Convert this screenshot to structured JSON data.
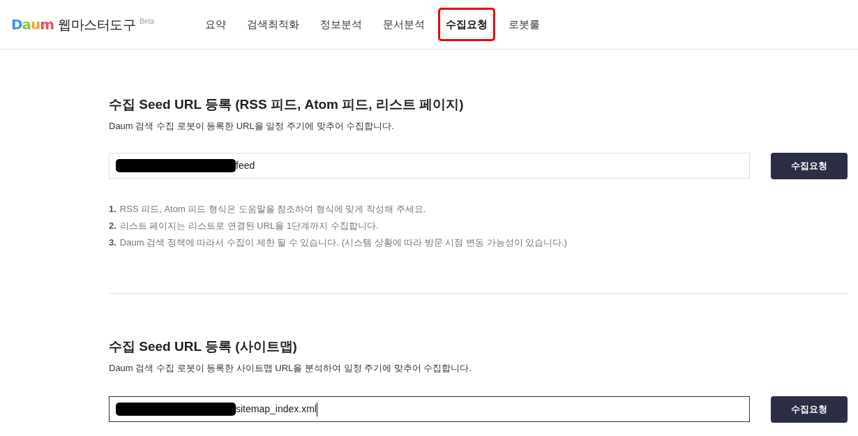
{
  "header": {
    "logo": [
      {
        "char": "D",
        "color": "#3f8ff0"
      },
      {
        "char": "a",
        "color": "#8dc63f"
      },
      {
        "char": "u",
        "color": "#f7a823"
      },
      {
        "char": "m",
        "color": "#ee4b5a"
      }
    ],
    "title": "웹마스터도구",
    "badge": "Beta"
  },
  "tabs": [
    {
      "label": "요약",
      "selected": false
    },
    {
      "label": "검색최적화",
      "selected": false
    },
    {
      "label": "정보분석",
      "selected": false
    },
    {
      "label": "문서분석",
      "selected": false
    },
    {
      "label": "수집요청",
      "selected": true
    },
    {
      "label": "로봇룰",
      "selected": false
    }
  ],
  "sections": [
    {
      "title": "수집 Seed URL 등록 (RSS 피드, Atom 피드, 리스트 페이지)",
      "description": "Daum 검색 수집 로봇이 등록한 URL을 일정 주기에 맞추어 수집합니다.",
      "field": {
        "redacted": true,
        "value": "feed",
        "focused": false
      },
      "button": "수집요청",
      "notes": [
        {
          "number": "1.",
          "text": "RSS 피드, Atom 피드 형식은 도움말을 참조하여 형식에 맞게 작성해 주세요."
        },
        {
          "number": "2.",
          "text": "리스트 페이지는 리스트로 연결된 URL을 1단계까지 수집합니다."
        },
        {
          "number": "3.",
          "text": "Daum 검색 정책에 따라서 수집이 제한 될 수 있습니다. (시스템 상황에 따라 방문 시점 변동 가능성이 있습니다.)"
        }
      ]
    },
    {
      "title": "수집 Seed URL 등록 (사이트맵)",
      "description": "Daum 검색 수집 로봇이 등록한 사이트맵 URL을 분석하여 일정 주기에 맞추어 수집합니다.",
      "field": {
        "redacted": true,
        "value": "sitemap_index.xml",
        "focused": true
      },
      "button": "수집요청"
    }
  ]
}
